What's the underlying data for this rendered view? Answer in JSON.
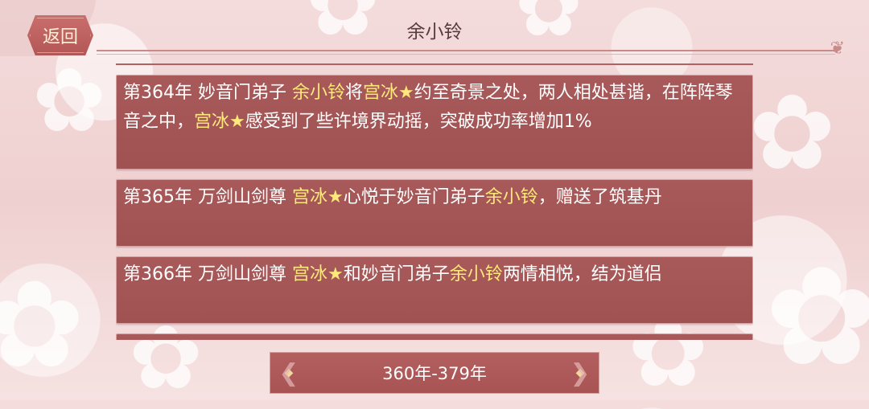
{
  "header": {
    "back_label": "返回",
    "title": "余小铃"
  },
  "entries": [
    {
      "parts": [
        {
          "t": "第364年 妙音门弟子 ",
          "hl": false
        },
        {
          "t": "余小铃",
          "hl": true
        },
        {
          "t": "将",
          "hl": false
        },
        {
          "t": "宫冰",
          "hl": true
        },
        {
          "t": "★",
          "hl": true
        },
        {
          "t": "约至奇景之处，两人相处甚谐，在阵阵琴音之中，",
          "hl": false
        },
        {
          "t": "宫冰",
          "hl": true
        },
        {
          "t": "★",
          "hl": true
        },
        {
          "t": "感受到了些许境界动摇，突破成功率增加1%",
          "hl": false
        }
      ]
    },
    {
      "parts": [
        {
          "t": "第365年 万剑山剑尊 ",
          "hl": false
        },
        {
          "t": "宫冰",
          "hl": true
        },
        {
          "t": "★",
          "hl": true
        },
        {
          "t": "心悦于妙音门弟子",
          "hl": false
        },
        {
          "t": "余小铃",
          "hl": true
        },
        {
          "t": "，赠送了筑基丹",
          "hl": false
        }
      ]
    },
    {
      "parts": [
        {
          "t": "第366年 万剑山剑尊 ",
          "hl": false
        },
        {
          "t": "宫冰",
          "hl": true
        },
        {
          "t": "★",
          "hl": true
        },
        {
          "t": "和妙音门弟子",
          "hl": false
        },
        {
          "t": "余小铃",
          "hl": true
        },
        {
          "t": "两情相悦，结为道侣",
          "hl": false
        }
      ]
    },
    {
      "parts": [
        {
          "t": "",
          "hl": false
        }
      ]
    }
  ],
  "pager": {
    "range_label": "360年-379年",
    "prev_icon": "diamond-arrow-left",
    "next_icon": "diamond-arrow-right"
  },
  "colors": {
    "entry_bg": "#a85959",
    "highlight": "#ffe97a"
  }
}
